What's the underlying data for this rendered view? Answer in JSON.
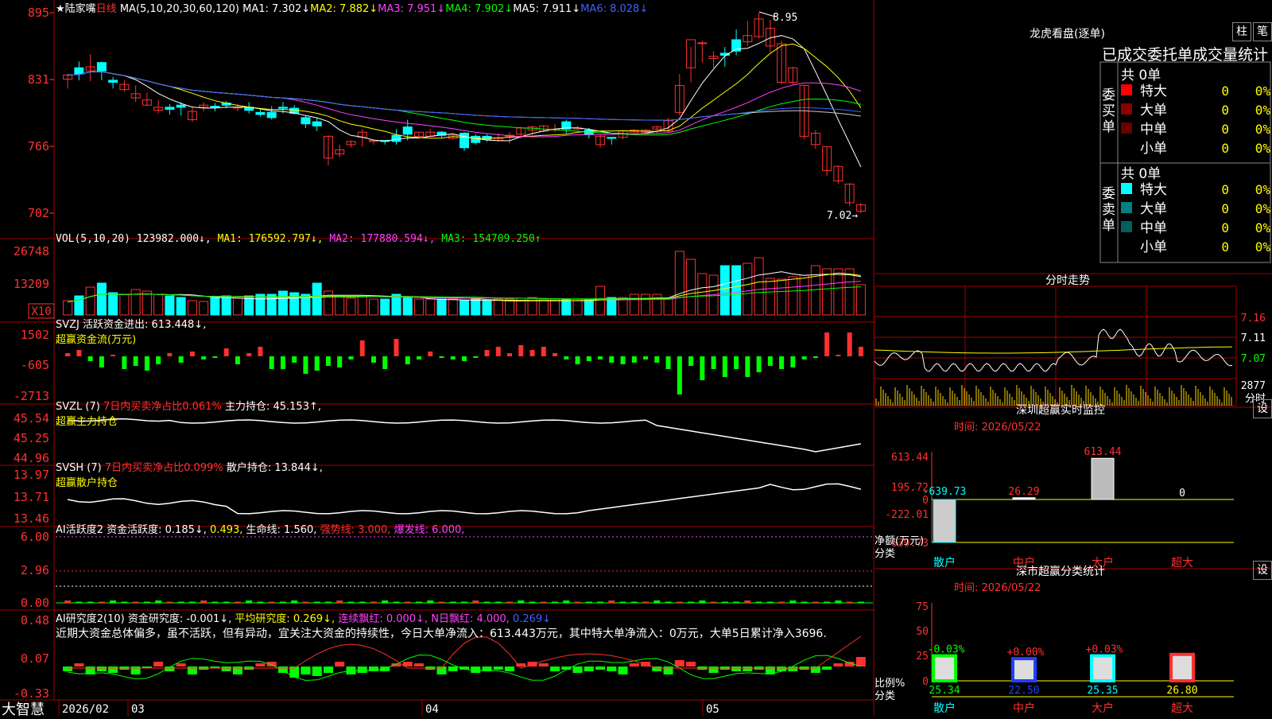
{
  "app": {
    "brand": "大智慧"
  },
  "header": {
    "stock_name": "陆家嘴",
    "period": "日线",
    "ma_def": "MA(5,10,20,30,60,120)",
    "ma1": "MA1: 7.302↓",
    "ma2": "MA2: 7.882↓",
    "ma3": "MA3: 7.951↓",
    "ma4": "MA4: 7.902↓",
    "ma5": "MA5: 7.911↓",
    "ma6": "MA6: 8.028↓"
  },
  "price_panel": {
    "axis": [
      "895",
      "831",
      "766",
      "702"
    ],
    "high_label": "8.95",
    "low_label": "7.02→"
  },
  "vol_panel": {
    "title": "VOL(5,10,20)",
    "value": "123982.000↓,",
    "ma1": "MA1: 176592.797↓,",
    "ma2": "MA2: 177880.594↓,",
    "ma3": "MA3: 154709.250↑",
    "axis": [
      "26748",
      "13209"
    ],
    "unit": "X10"
  },
  "svzj_panel": {
    "title": "SVZJ",
    "label": "活跃资金进出: 613.448↓,",
    "sub": "超赢资金流(万元)",
    "axis": [
      "1502",
      "-605",
      "-2713"
    ]
  },
  "svzl_panel": {
    "title": "SVZL (7)",
    "ratio": "7日内买卖净占比0.061%",
    "label": "主力持仓: 45.153↑,",
    "sub": "超赢主力持仓",
    "axis": [
      "45.54",
      "45.25",
      "44.96"
    ]
  },
  "svsh_panel": {
    "title": "SVSH (7)",
    "ratio": "7日内买卖净占比0.099%",
    "label": "散户持仓: 13.844↓,",
    "sub": "超赢散户持仓",
    "axis": [
      "13.97",
      "13.71",
      "13.46"
    ]
  },
  "ai_active": {
    "title": "AI活跃度2",
    "l1": "资金活跃度: 0.185↓,",
    "l2": "0.493,",
    "l3": "生命线: 1.560,",
    "l4": "强势线: 3.000,",
    "l5": "爆发线: 6.000,",
    "axis": [
      "6.00",
      "2.96",
      "0.00"
    ]
  },
  "ai_research": {
    "title": "AI研究度2(10)",
    "l1": "资金研究度: -0.001↓,",
    "l2": "平均研究度: 0.269↓,",
    "l3": "连续飘红: 0.000↓,",
    "l4": "N日飘红: 4.000,",
    "l5": "0.269↓",
    "text": "近期大资金总体偏多，虽不活跃，但有异动，宜关注大资金的持续性，今日大单净流入：613.443万元，其中特大单净流入：0万元，大单5日累计净入3696.",
    "axis": [
      "0.48",
      "0.07",
      "-0.33"
    ]
  },
  "date_axis": [
    "2026/02",
    "03",
    "04",
    "05"
  ],
  "side": {
    "dragon_title": "龙虎看盘(逐单)",
    "tab_zhu": "柱",
    "tab_bi": "笔",
    "tabs_row": "已成交委托单成交量统计",
    "buy_total": "共 0单",
    "buy_label": "委买单",
    "sell_total": "共 0单",
    "sell_label": "委卖单",
    "rows": [
      {
        "name": "特大",
        "v": "0",
        "p": "0%"
      },
      {
        "name": "大单",
        "v": "0",
        "p": "0%"
      },
      {
        "name": "中单",
        "v": "0",
        "p": "0%"
      },
      {
        "name": "小单",
        "v": "0",
        "p": "0%"
      }
    ],
    "minute_title": "分时走势",
    "minute_axis": [
      "7.16",
      "7.11",
      "7.07",
      "2877",
      "分时"
    ],
    "monitor_title": "深圳超赢实时监控",
    "monitor_time": "时间: 2026/05/22",
    "monitor_axis": [
      "613.44",
      "195.72",
      "0",
      "-222.01",
      "-639.73"
    ],
    "monitor_vals": [
      "-639.73",
      "26.29",
      "613.44",
      "0"
    ],
    "monitor_ylabel": "净额(万元)",
    "monitor_xlabel": "分类",
    "cats": [
      "散户",
      "中户",
      "大户",
      "超大"
    ],
    "stat_title": "深市超赢分类统计",
    "stat_time": "时间: 2026/05/22",
    "stat_axis": [
      "75",
      "50",
      "25",
      "0"
    ],
    "stat_changes": [
      "-0.03%",
      "+0.00%",
      "+0.03%"
    ],
    "stat_vals": [
      "25.34",
      "22.50",
      "25.35",
      "26.80"
    ],
    "stat_ylabel": "比例%",
    "stat_xlabel": "分类",
    "set_btn": "设"
  },
  "chart_data": [
    {
      "type": "candlestick",
      "title": "陆家嘴 日线",
      "ylim": [
        7.02,
        8.95
      ],
      "ohlc": [
        [
          8.31,
          8.35,
          8.22,
          8.36
        ],
        [
          8.42,
          8.36,
          8.3,
          8.48
        ],
        [
          8.39,
          8.43,
          8.29,
          8.55
        ],
        [
          8.47,
          8.39,
          8.3,
          8.48
        ],
        [
          8.3,
          8.28,
          8.22,
          8.33
        ],
        [
          8.21,
          8.26,
          8.19,
          8.3
        ],
        [
          8.13,
          8.17,
          8.09,
          8.25
        ],
        [
          8.06,
          8.11,
          8.05,
          8.18
        ],
        [
          8.01,
          8.04,
          7.98,
          8.11
        ],
        [
          8.04,
          8.02,
          7.97,
          8.07
        ],
        [
          8.06,
          8.04,
          7.96,
          8.09
        ],
        [
          7.92,
          8.0,
          7.9,
          8.05
        ],
        [
          8.04,
          8.06,
          8.0,
          8.09
        ],
        [
          8.05,
          8.04,
          8.0,
          8.08
        ],
        [
          8.08,
          8.06,
          8.03,
          8.1
        ],
        [
          8.04,
          8.04,
          8.0,
          8.07
        ],
        [
          8.04,
          8.01,
          7.98,
          8.09
        ],
        [
          7.99,
          7.97,
          7.95,
          8.03
        ],
        [
          7.99,
          7.94,
          7.92,
          8.05
        ],
        [
          8.04,
          8.03,
          7.98,
          8.09
        ],
        [
          8.03,
          7.98,
          7.97,
          8.06
        ],
        [
          7.94,
          7.88,
          7.84,
          7.96
        ],
        [
          7.9,
          7.86,
          7.81,
          7.94
        ],
        [
          7.55,
          7.76,
          7.48,
          7.77
        ],
        [
          7.59,
          7.63,
          7.56,
          7.68
        ],
        [
          7.68,
          7.71,
          7.65,
          7.72
        ],
        [
          7.75,
          7.8,
          7.66,
          7.83
        ],
        [
          7.71,
          7.72,
          7.68,
          7.72
        ],
        [
          7.72,
          7.71,
          7.68,
          7.72
        ],
        [
          7.77,
          7.71,
          7.68,
          7.83
        ],
        [
          7.85,
          7.78,
          7.72,
          7.92
        ],
        [
          7.76,
          7.8,
          7.76,
          7.8
        ],
        [
          7.76,
          7.8,
          7.76,
          7.83
        ],
        [
          7.8,
          7.77,
          7.75,
          7.81
        ],
        [
          7.74,
          7.77,
          7.73,
          7.79
        ],
        [
          7.79,
          7.65,
          7.62,
          7.8
        ],
        [
          7.76,
          7.7,
          7.68,
          7.78
        ],
        [
          7.76,
          7.73,
          7.71,
          7.78
        ],
        [
          7.72,
          7.74,
          7.71,
          7.79
        ],
        [
          7.76,
          7.77,
          7.69,
          7.8
        ],
        [
          7.78,
          7.84,
          7.74,
          7.85
        ],
        [
          7.82,
          7.85,
          7.78,
          7.86
        ],
        [
          7.81,
          7.86,
          7.8,
          7.87
        ],
        [
          7.82,
          7.83,
          7.8,
          7.88
        ],
        [
          7.9,
          7.83,
          7.79,
          7.92
        ],
        [
          7.83,
          7.84,
          7.82,
          7.86
        ],
        [
          7.82,
          7.78,
          7.74,
          7.84
        ],
        [
          7.68,
          7.76,
          7.65,
          7.78
        ],
        [
          7.75,
          7.74,
          7.68,
          7.74
        ],
        [
          7.75,
          7.81,
          7.73,
          7.81
        ],
        [
          7.8,
          7.82,
          7.8,
          7.83
        ],
        [
          7.8,
          7.82,
          7.79,
          7.83
        ],
        [
          7.83,
          7.85,
          7.79,
          7.86
        ],
        [
          7.81,
          7.91,
          7.8,
          7.94
        ],
        [
          7.99,
          8.25,
          7.96,
          8.36
        ],
        [
          8.42,
          8.69,
          8.28,
          8.62
        ],
        [
          8.66,
          8.66,
          8.47,
          8.68
        ],
        [
          8.51,
          8.53,
          8.42,
          8.58
        ],
        [
          8.56,
          8.54,
          8.43,
          8.62
        ],
        [
          8.69,
          8.58,
          8.54,
          8.79
        ],
        [
          8.67,
          8.73,
          8.63,
          8.87
        ],
        [
          8.72,
          8.89,
          8.7,
          8.95
        ],
        [
          8.63,
          8.8,
          8.57,
          8.88
        ],
        [
          8.28,
          8.65,
          8.26,
          8.68
        ],
        [
          8.28,
          8.42,
          8.26,
          8.43
        ],
        [
          7.76,
          8.25,
          7.73,
          8.26
        ],
        [
          7.68,
          7.79,
          7.64,
          7.82
        ],
        [
          7.43,
          7.66,
          7.38,
          7.66
        ],
        [
          7.33,
          7.47,
          7.3,
          7.48
        ],
        [
          7.12,
          7.3,
          7.09,
          7.31
        ],
        [
          7.04,
          7.1,
          7.02,
          7.12
        ]
      ]
    }
  ]
}
